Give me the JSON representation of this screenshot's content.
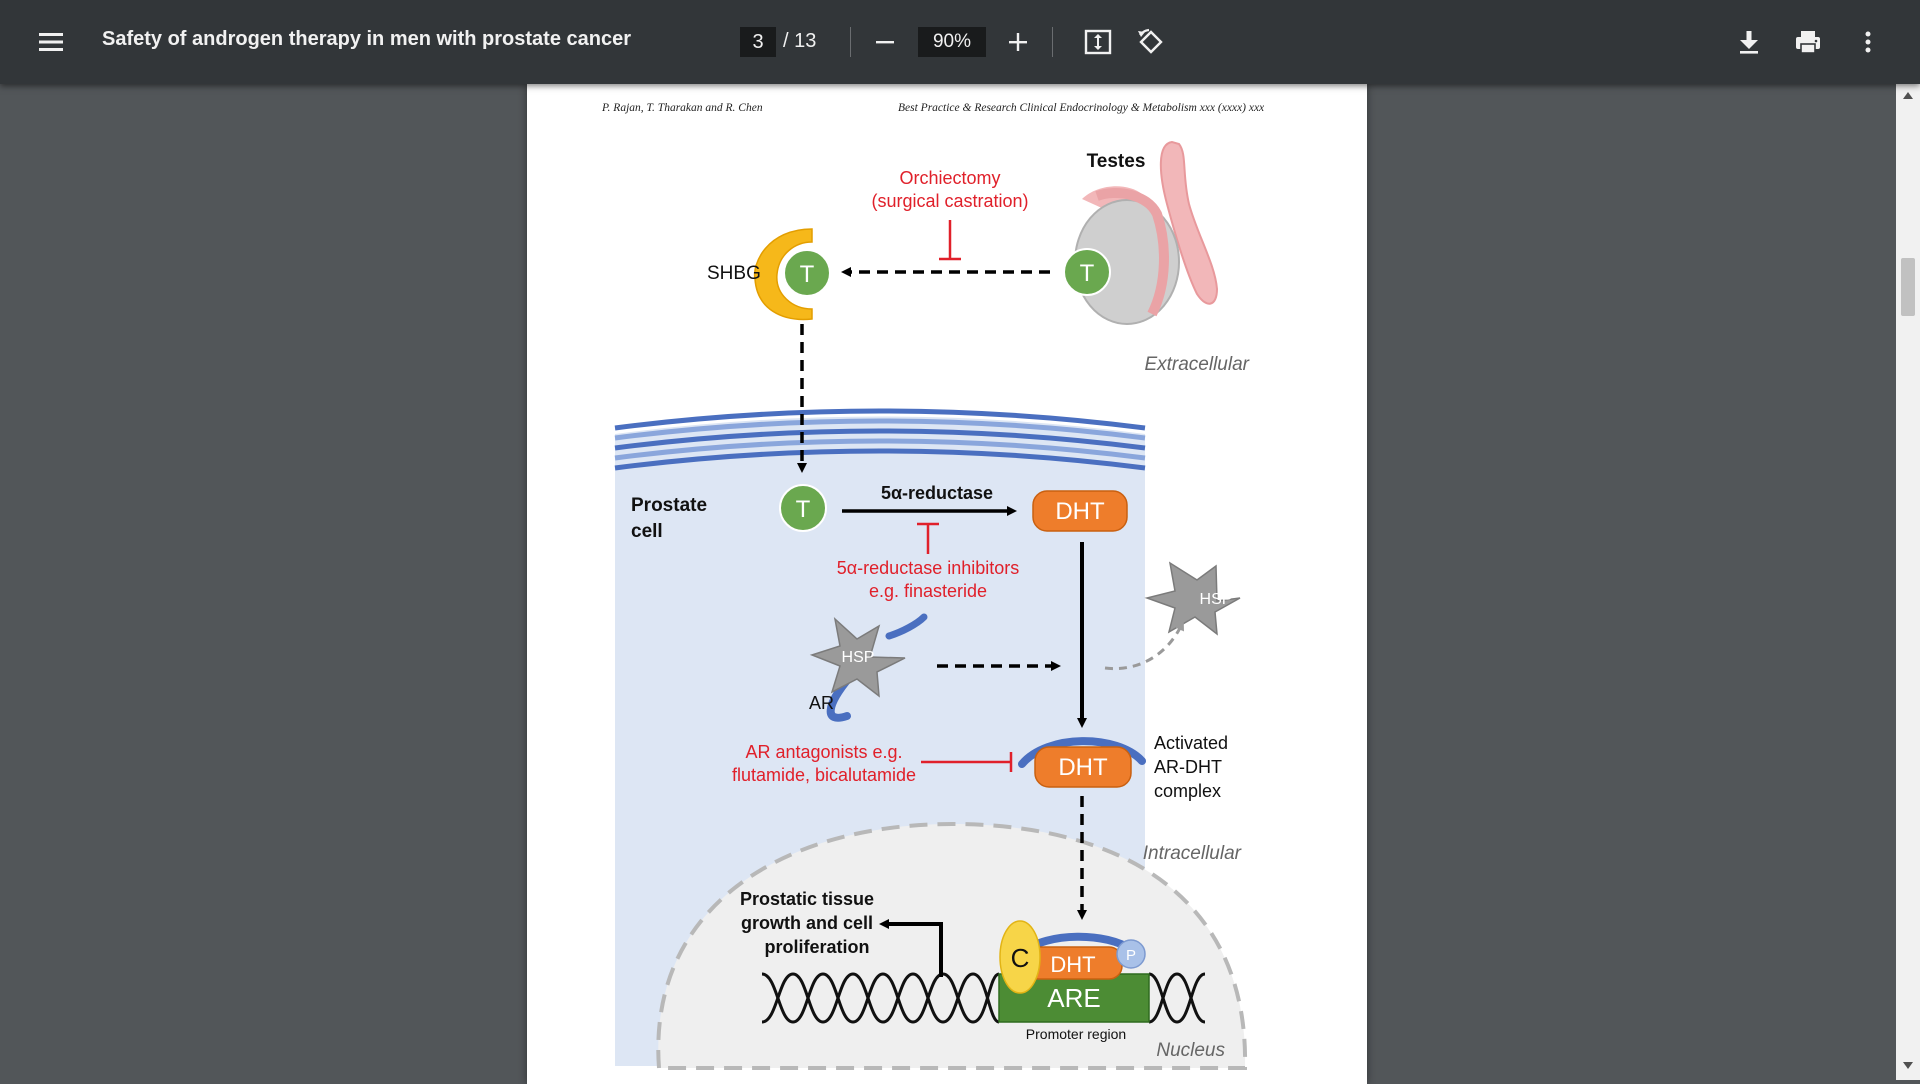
{
  "toolbar": {
    "menu_icon": "hamburger-menu-icon",
    "title": "Safety of androgen therapy in men with prostate cancer",
    "current_page": "3",
    "total_pages": "/ 13",
    "zoom": "90%",
    "zoom_out_icon": "minus-icon",
    "zoom_in_icon": "plus-icon",
    "fit_icon": "fit-to-page-icon",
    "rotate_icon": "rotate-icon",
    "download_icon": "download-icon",
    "print_icon": "print-icon",
    "more_icon": "more-vertical-icon"
  },
  "page": {
    "running_head_left": "P. Rajan, T. Tharakan and R. Chen",
    "running_head_right": "Best Practice & Research Clinical Endocrinology & Metabolism xxx (xxxx) xxx"
  },
  "figure": {
    "testes_label": "Testes",
    "orchiectomy_line1": "Orchiectomy",
    "orchiectomy_line2": "(surgical castration)",
    "shbg_label": "SHBG",
    "t_label": "T",
    "extracellular_label": "Extracellular",
    "prostate_cell_line1": "Prostate",
    "prostate_cell_line2": "cell",
    "reductase_label": "5α-reductase",
    "dht_label": "DHT",
    "inhibitor_line1": "5α-reductase inhibitors",
    "inhibitor_line2": "e.g. finasteride",
    "hsp_label": "HSP",
    "ar_label": "AR",
    "antagonist_line1": "AR antagonists e.g.",
    "antagonist_line2": "flutamide, bicalutamide",
    "complex_line1": "Activated",
    "complex_line2": "AR-DHT",
    "complex_line3": "complex",
    "intracellular_label": "Intracellular",
    "growth_line1": "Prostatic tissue",
    "growth_line2": "growth and cell",
    "growth_line3": "proliferation",
    "c_label": "C",
    "p_label": "P",
    "are_label": "ARE",
    "promoter_label": "Promoter region",
    "nucleus_label": "Nucleus"
  },
  "colors": {
    "toolbar_bg": "#323639",
    "viewer_bg": "#525659",
    "inhibit_red": "#e0202a",
    "t_green": "#6aa84f",
    "dht_orange": "#ee7d2b",
    "shbg_yellow": "#f6b81a",
    "membrane_blue": "#4a6fc0",
    "cell_fill": "#dde6f4",
    "are_green": "#4c8c34"
  }
}
